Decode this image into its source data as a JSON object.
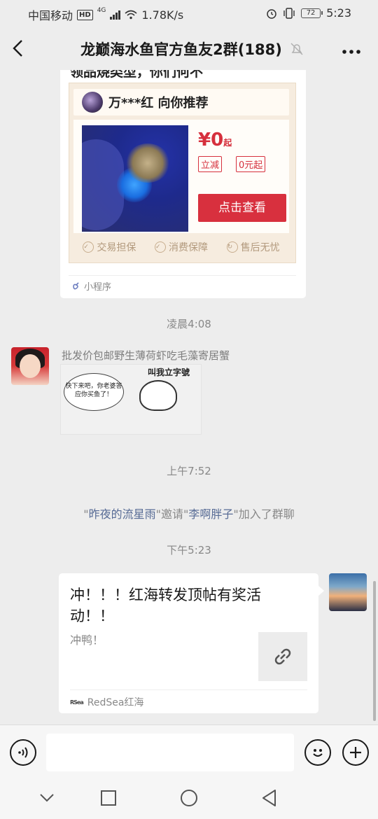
{
  "status_bar": {
    "carrier": "中国移动",
    "hd": "HD",
    "network": "4G",
    "speed": "1.78K/s",
    "battery": "72",
    "time": "5:23"
  },
  "header": {
    "title": "龙巅海水鱼官方鱼友2群(188)"
  },
  "messages": {
    "cut_text": "领品烧类型，你们何不",
    "mini_program": {
      "header": "万***红 向你推荐",
      "price": "¥0",
      "price_suffix": "起",
      "tag1": "立减",
      "tag2": "0元起",
      "cta": "点击查看",
      "guarantee1": "交易担保",
      "guarantee2": "消费保障",
      "guarantee3": "售后无忧",
      "source": "小程序"
    },
    "time1": "凌晨4:08",
    "sender_name": "批发价包邮野生薄荷虾吃毛藻寄居蟹",
    "sticker": {
      "bubble": "快下来吧，你老婆答应你买鱼了！",
      "top_text": "叫我立字號"
    },
    "time2": "上午7:52",
    "system": {
      "q1": "\"",
      "inviter": "昨夜的流星雨",
      "mid": "\"邀请\"",
      "invitee": "李啊胖子",
      "end": "\"加入了群聊"
    },
    "time3": "下午5:23",
    "link_card": {
      "title": "冲！！！红海转发顶帖有奖活动！！",
      "desc": "冲鸭！",
      "source": "RedSea红海",
      "source_logo": "RSea"
    }
  },
  "input_bar": {
    "placeholder": ""
  },
  "colors": {
    "background": "#ededed",
    "link_blue": "#576b95",
    "cta_red": "#d8303e"
  }
}
